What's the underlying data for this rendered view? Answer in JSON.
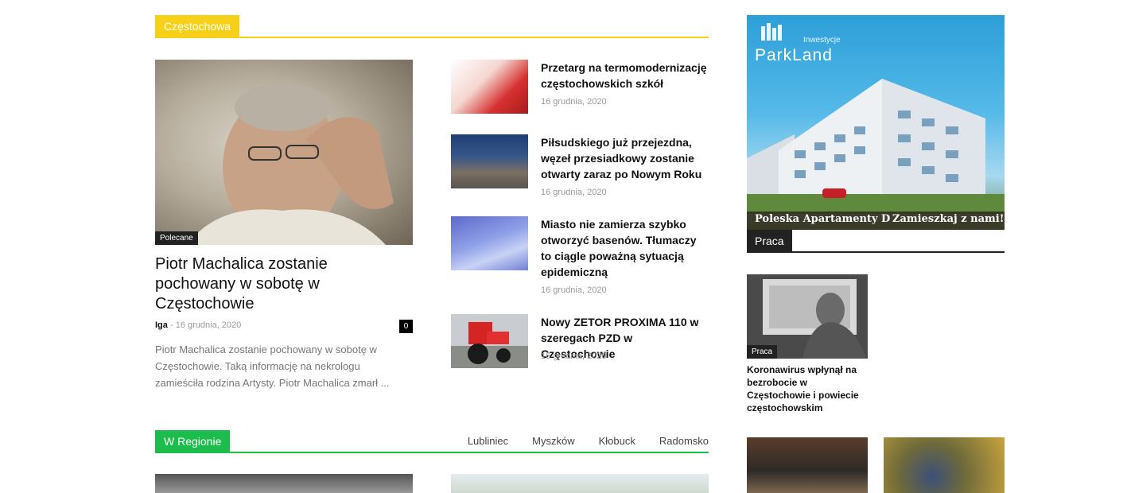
{
  "section_czestochowa": {
    "label": "Częstochowa"
  },
  "feature": {
    "category": "Polecane",
    "title": "Piotr Machalica zostanie pochowany w sobotę w Częstochowie",
    "author": "Iga",
    "separator": "-",
    "date": "16 grudnia, 2020",
    "comments": "0",
    "excerpt": "Piotr Machalica zostanie pochowany w sobotę w Częstochowie. Taką informację na nekrologu zamieściła rodzina Artysty. Piotr Machalica zmarł ..."
  },
  "side_list": [
    {
      "title": "Przetarg na termomodernizację częstochowskich szkół",
      "date": "16 grudnia, 2020"
    },
    {
      "title": "Piłsudskiego już przejezdna, węzeł przesiadkowy zostanie otwarty zaraz po Nowym Roku",
      "date": "16 grudnia, 2020"
    },
    {
      "title": "Miasto nie zamierza szybko otworzyć basenów. Tłumaczy to ciągle poważną sytuacją epidemiczną",
      "date": "16 grudnia, 2020"
    },
    {
      "title": "Nowy ZETOR PROXIMA 110 w szeregach PZD w Częstochowie",
      "date": "16 grudnia, 2020"
    }
  ],
  "section_region": {
    "label": "W Regionie",
    "tabs": [
      "Lubliniec",
      "Myszków",
      "Kłobuck",
      "Radomsko"
    ]
  },
  "ad": {
    "brand_sub": "Inwestycje",
    "brand": "ParkLand",
    "left_text": "Poleska Apartamenty D",
    "right_text": "Zamieszkaj z nami!"
  },
  "section_praca": {
    "label": "Praca",
    "item": {
      "category": "Praca",
      "title": "Koronawirus wpłynął na bezrobocie w Częstochowie i powiecie częstochowskim"
    }
  }
}
